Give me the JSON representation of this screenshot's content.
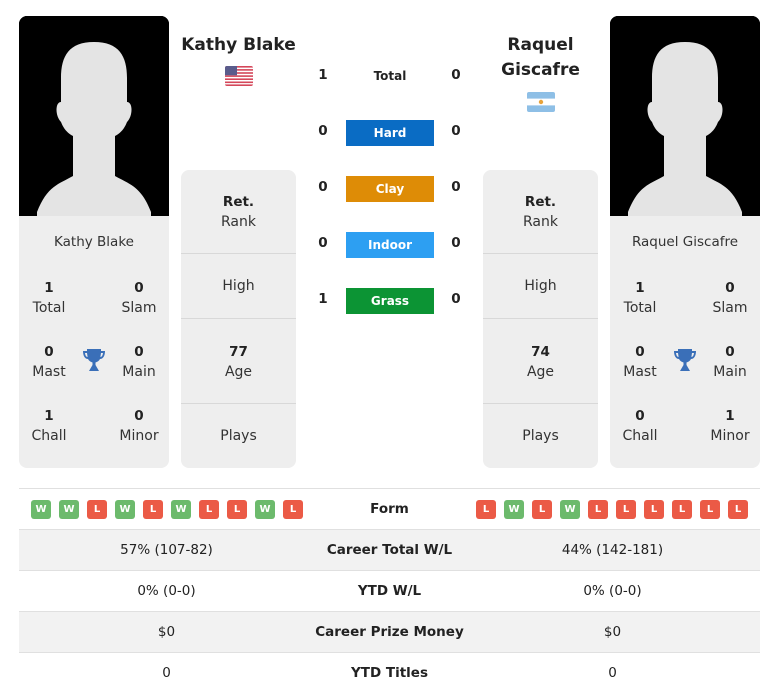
{
  "colors": {
    "hard": "#0a6cc4",
    "clay": "#de8c06",
    "indoor": "#2d9ff2",
    "grass": "#0c9434",
    "win": "#6cba6c",
    "loss": "#eb5a46",
    "trophy": "#3a6fb8"
  },
  "player1": {
    "name": "Kathy Blake",
    "flag": "usa-flag",
    "card": {
      "name": "Kathy Blake",
      "stats": [
        {
          "num": "1",
          "label": "Total"
        },
        {
          "num": "0",
          "label": "Slam"
        },
        {
          "num": "0",
          "label": "Mast"
        },
        {
          "num": "0",
          "label": "Main"
        },
        {
          "num": "1",
          "label": "Chall"
        },
        {
          "num": "0",
          "label": "Minor"
        }
      ]
    },
    "info": {
      "rank_value": "Ret.",
      "rank_label": "Rank",
      "high_label": "High",
      "age_value": "77",
      "age_label": "Age",
      "plays_label": "Plays"
    },
    "form": [
      "W",
      "W",
      "L",
      "W",
      "L",
      "W",
      "L",
      "L",
      "W",
      "L"
    ],
    "career_wl": "57% (107-82)",
    "ytd_wl": "0% (0-0)",
    "prize_money": "$0",
    "ytd_titles": "0"
  },
  "player2": {
    "name": "Raquel Giscafre",
    "name_line1": "Raquel",
    "name_line2": "Giscafre",
    "flag": "argentina-flag",
    "card": {
      "name": "Raquel Giscafre",
      "stats": [
        {
          "num": "1",
          "label": "Total"
        },
        {
          "num": "0",
          "label": "Slam"
        },
        {
          "num": "0",
          "label": "Mast"
        },
        {
          "num": "0",
          "label": "Main"
        },
        {
          "num": "0",
          "label": "Chall"
        },
        {
          "num": "1",
          "label": "Minor"
        }
      ]
    },
    "info": {
      "rank_value": "Ret.",
      "rank_label": "Rank",
      "high_label": "High",
      "age_value": "74",
      "age_label": "Age",
      "plays_label": "Plays"
    },
    "form": [
      "L",
      "W",
      "L",
      "W",
      "L",
      "L",
      "L",
      "L",
      "L",
      "L"
    ],
    "career_wl": "44% (142-181)",
    "ytd_wl": "0% (0-0)",
    "prize_money": "$0",
    "ytd_titles": "0"
  },
  "h2h": {
    "total": {
      "label": "Total",
      "p1": "1",
      "p2": "0"
    },
    "surfaces": [
      {
        "label": "Hard",
        "p1": "0",
        "p2": "0"
      },
      {
        "label": "Clay",
        "p1": "0",
        "p2": "0"
      },
      {
        "label": "Indoor",
        "p1": "0",
        "p2": "0"
      },
      {
        "label": "Grass",
        "p1": "1",
        "p2": "0"
      }
    ]
  },
  "table": {
    "form_label": "Form",
    "career_wl_label": "Career Total W/L",
    "ytd_wl_label": "YTD W/L",
    "prize_label": "Career Prize Money",
    "ytd_titles_label": "YTD Titles"
  }
}
